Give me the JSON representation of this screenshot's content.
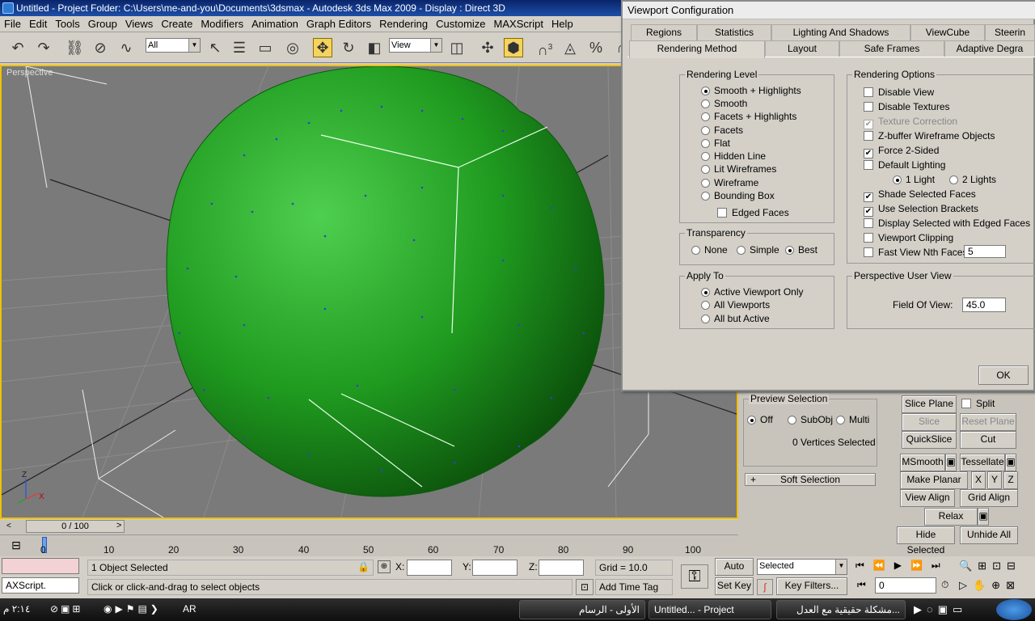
{
  "window": {
    "title": "Untitled      - Project Folder: C:\\Users\\me-and-you\\Documents\\3dsmax     - Autodesk 3ds Max  2009       - Display : Direct 3D"
  },
  "menu": [
    "File",
    "Edit",
    "Tools",
    "Group",
    "Views",
    "Create",
    "Modifiers",
    "Animation",
    "Graph Editors",
    "Rendering",
    "Customize",
    "MAXScript",
    "Help"
  ],
  "toolbar": {
    "selection_filter": "All",
    "ref_coord": "View",
    "snap_label": "3",
    "percent_label": "%"
  },
  "viewport": {
    "label": "Perspective",
    "mesh_color": "#1f9a1f",
    "bg_color": "#7a7a7a",
    "axis_x": "X",
    "axis_z": "Z"
  },
  "timeslider": {
    "frame": "0 / 100",
    "ticks": [
      "0",
      "10",
      "20",
      "30",
      "40",
      "50",
      "60",
      "70",
      "80",
      "90",
      "100"
    ]
  },
  "status": {
    "selected": "1 Object Selected",
    "prompt": "Click or click-and-drag to select objects",
    "maxscript": "AXScript.",
    "x_label": "X:",
    "y_label": "Y:",
    "z_label": "Z:",
    "grid": "Grid = 10.0",
    "add_time_tag": "Add Time Tag",
    "auto_key": "Auto Key",
    "set_key": "Set Key",
    "key_mode": "Selected",
    "key_filters": "Key Filters...",
    "frame_value": "0"
  },
  "cmd": {
    "preview_selection": "Preview Selection",
    "preview_off": "Off",
    "preview_subobj": "SubObj",
    "preview_multi": "Multi",
    "vertices_selected": "0 Vertices Selected",
    "soft_selection": "Soft Selection",
    "slice_plane": "Slice Plane",
    "split": "Split",
    "slice": "Slice",
    "reset_plane": "Reset Plane",
    "quickslice": "QuickSlice",
    "cut": "Cut",
    "msmooth": "MSmooth",
    "tessellate": "Tessellate",
    "make_planar": "Make Planar",
    "x": "X",
    "y": "Y",
    "z": "Z",
    "view_align": "View Align",
    "grid_align": "Grid Align",
    "relax": "Relax",
    "hide_selected": "Hide Selected",
    "unhide_all": "Unhide All"
  },
  "dialog": {
    "title": "Viewport Configuration",
    "tabs_row1": [
      "Regions",
      "Statistics",
      "Lighting And Shadows",
      "ViewCube",
      "Steerin"
    ],
    "tabs_row2": [
      "Rendering Method",
      "Layout",
      "Safe Frames",
      "Adaptive Degra"
    ],
    "rendering_level": {
      "title": "Rendering Level",
      "options": [
        "Smooth + Highlights",
        "Smooth",
        "Facets + Highlights",
        "Facets",
        "Flat",
        "Hidden Line",
        "Lit Wireframes",
        "Wireframe",
        "Bounding Box"
      ],
      "edged_faces": "Edged Faces"
    },
    "transparency": {
      "title": "Transparency",
      "options": [
        "None",
        "Simple",
        "Best"
      ]
    },
    "apply_to": {
      "title": "Apply To",
      "options": [
        "Active Viewport Only",
        "All Viewports",
        "All but Active"
      ]
    },
    "rendering_options": {
      "title": "Rendering Options",
      "items": [
        "Disable View",
        "Disable Textures",
        "Texture Correction",
        "Z-buffer Wireframe Objects",
        "Force 2-Sided",
        "Default Lighting"
      ],
      "one_light": "1 Light",
      "two_lights": "2 Lights",
      "items2": [
        "Shade Selected Faces",
        "Use Selection Brackets",
        "Display Selected with Edged Faces",
        "Viewport Clipping",
        "Fast View Nth Faces:"
      ],
      "nth_value": "5"
    },
    "perspective": {
      "title": "Perspective User View",
      "fov_label": "Field Of View:",
      "fov_value": "45.0"
    },
    "ok": "OK"
  },
  "taskbar": {
    "time": "٢:١٤ م",
    "lang": "AR",
    "tasks": [
      "الأولى - الرسام",
      "Untitled...   - Project",
      "مشكلة حقيقية مع العدل..."
    ]
  }
}
